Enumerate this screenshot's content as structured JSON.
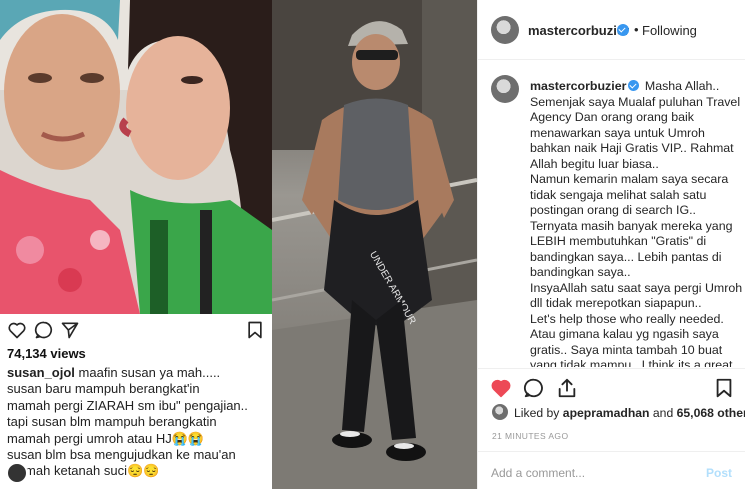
{
  "left_post": {
    "views": "74,134 views",
    "caption_user": "susan_ojol",
    "caption_lines": [
      "maafin susan ya mah.....",
      "susan baru mampuh  berangkat'in",
      "mamah pergi ZIARAH sm ibu\" pengajian..",
      "tapi susan blm mampuh  berangkatin",
      "mamah pergi umroh atau HJ😭😭",
      "susan blm bsa mengujudkan ke mau'an",
      "mamah ketanah suci😔😔"
    ]
  },
  "middle_photo": {
    "shirt_print": "UNDER ARMOUR"
  },
  "right_panel": {
    "header": {
      "username": "mastercorbuzier",
      "separator": "•",
      "follow_status": "Following"
    },
    "comment": {
      "username": "mastercorbuzier",
      "first_line_text": "Masha Allah..",
      "lines": [
        "Semenjak saya Mualaf puluhan Travel",
        "Agency Dan orang orang baik",
        "menawarkan saya untuk Umroh",
        "bahkan naik Haji Gratis VIP.. Rahmat",
        "Allah begitu luar biasa..",
        "Namun kemarin malam saya secara",
        "tidak sengaja melihat salah satu",
        "postingan orang di search IG..",
        "Ternyata masih banyak mereka yang",
        "LEBIH membutuhkan \"Gratis\" di",
        "bandingkan saya... Lebih pantas di",
        "bandingkan saya..",
        "InsyaAllah satu saat saya pergi Umroh",
        "dll tidak merepotkan siapapun..",
        "Let's help those who really needed.",
        "Atau gimana kalau yg ngasih saya",
        "gratis.. Saya minta tambah 10 buat",
        "yang tidak mampu.. I think its a great"
      ]
    },
    "likes": {
      "prefix": "Liked by",
      "user": "apepramadhan",
      "connector": "and",
      "count": "65,068 others"
    },
    "time_ago": "21 MINUTES AGO",
    "add_comment": {
      "placeholder": "Add a comment...",
      "post_label": "Post"
    },
    "colors": {
      "heart": "#ed4956",
      "verified": "#3897f0",
      "post_button": "#b2dffc"
    }
  }
}
